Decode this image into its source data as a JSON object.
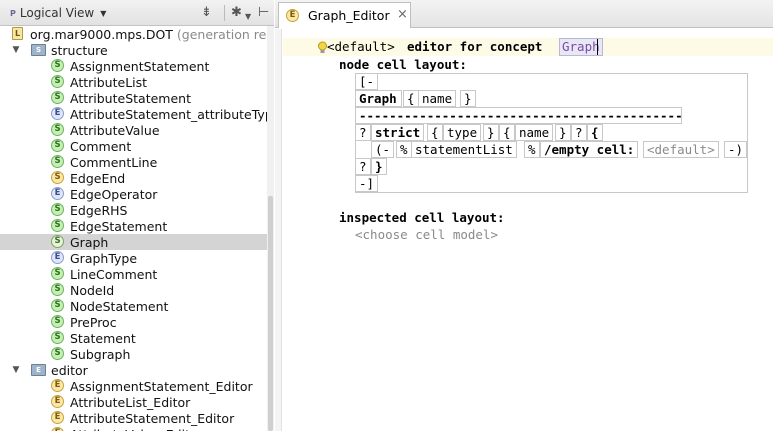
{
  "left_panel": {
    "view_label": "Logical View",
    "root": {
      "name": "org.mar9000.mps.DOT",
      "note": "(generation re"
    },
    "structure_label": "structure",
    "structure_items": [
      {
        "label": "AssignmentStatement",
        "icon": "S"
      },
      {
        "label": "AttributeList",
        "icon": "S"
      },
      {
        "label": "AttributeStatement",
        "icon": "S"
      },
      {
        "label": "AttributeStatement_attributeTyp",
        "icon": "E"
      },
      {
        "label": "AttributeValue",
        "icon": "S"
      },
      {
        "label": "Comment",
        "icon": "S"
      },
      {
        "label": "CommentLine",
        "icon": "S"
      },
      {
        "label": "EdgeEnd",
        "icon": "S"
      },
      {
        "label": "EdgeOperator",
        "icon": "E"
      },
      {
        "label": "EdgeRHS",
        "icon": "S"
      },
      {
        "label": "EdgeStatement",
        "icon": "S"
      },
      {
        "label": "Graph",
        "icon": "S"
      },
      {
        "label": "GraphType",
        "icon": "E"
      },
      {
        "label": "LineComment",
        "icon": "S"
      },
      {
        "label": "NodeId",
        "icon": "S"
      },
      {
        "label": "NodeStatement",
        "icon": "S"
      },
      {
        "label": "PreProc",
        "icon": "S"
      },
      {
        "label": "Statement",
        "icon": "S"
      },
      {
        "label": "Subgraph",
        "icon": "S"
      }
    ],
    "editor_label": "editor",
    "editor_items": [
      {
        "label": "AssignmentStatement_Editor",
        "icon": "E"
      },
      {
        "label": "AttributeList_Editor",
        "icon": "E"
      },
      {
        "label": "AttributeStatement_Editor",
        "icon": "E"
      },
      {
        "label": "AttributeValue_Editor",
        "icon": "E"
      }
    ],
    "selected": "Graph"
  },
  "tab": {
    "label": "Graph_Editor",
    "close": "×"
  },
  "editor": {
    "default_tag": "<default>",
    "editor_for_concept": "editor for concept",
    "concept": "Graph",
    "node_cell_layout": "node cell layout:",
    "open_bracket": "[-",
    "graph_kw": "Graph",
    "brace_open": "{",
    "brace_close": "}",
    "name": "name",
    "separator": "-------------------------------------------",
    "question": "?",
    "strict_kw": "strict",
    "type": "type",
    "lbrace_bold": "{",
    "paren_open": "(-",
    "percent": "%",
    "statement_list": "statementList",
    "empty_cell": "/empty cell:",
    "default_ph": "<default>",
    "paren_close": "-)",
    "rbrace_bold": "}",
    "close_bracket": "-]",
    "inspected_cell_layout": "inspected cell layout:",
    "choose_cell_model": "<choose cell model>"
  },
  "colors": {
    "selection": "#d4d4d4",
    "highlight_line": "#fdfbe6",
    "concept_text": "#7a4aa6"
  }
}
